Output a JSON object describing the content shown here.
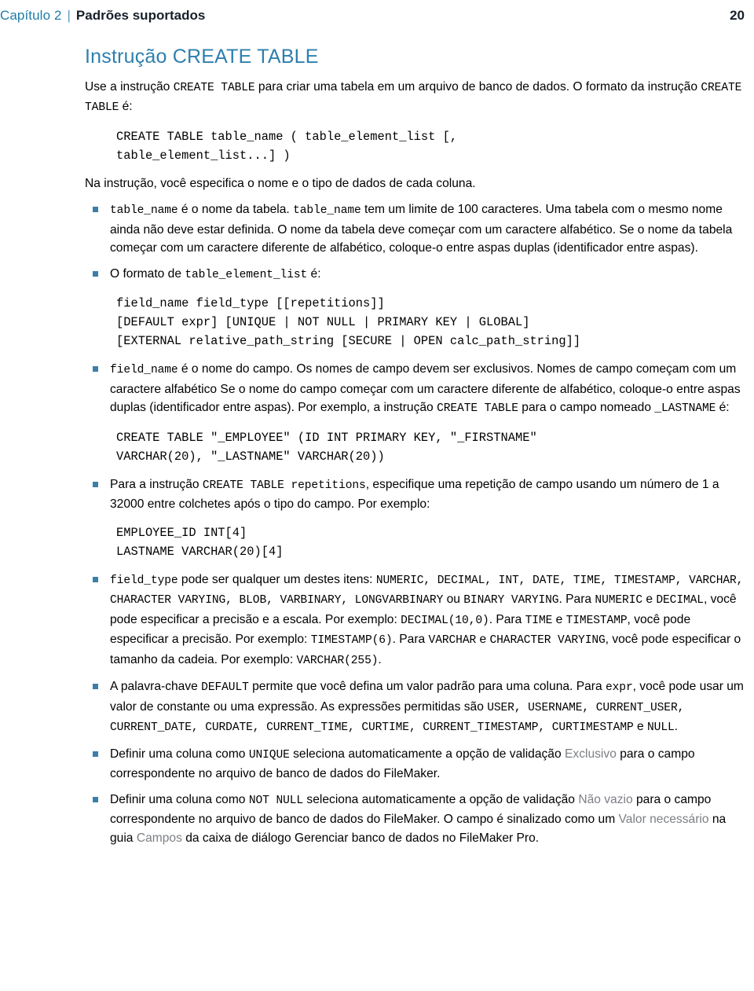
{
  "header": {
    "chapter": "Capítulo 2",
    "separator": "|",
    "section": "Padrões suportados",
    "page_number": "20"
  },
  "title": "Instrução CREATE TABLE",
  "intro": {
    "part1": "Use a instrução ",
    "code1": "CREATE TABLE",
    "part2": " para criar uma tabela em um arquivo de banco de dados. O formato da instrução ",
    "code2": "CREATE TABLE",
    "part3": " é:"
  },
  "code_block_1": "CREATE TABLE table_name ( table_element_list [,\ntable_element_list...] )",
  "para_after_code1": "Na instrução, você especifica o nome e o tipo de dados de cada coluna.",
  "bullets": {
    "table_name": {
      "code1": "table_name",
      "text1": " é o nome da tabela. ",
      "code2": "table_name",
      "text2": " tem um limite de 100 caracteres. Uma tabela com o mesmo nome ainda não deve estar definida. O nome da tabela deve começar com um caractere alfabético. Se o nome da tabela começar com um caractere diferente de alfabético, coloque-o entre aspas duplas (identificador entre aspas)."
    },
    "format_list": {
      "text1": "O formato de ",
      "code1": "table_element_list",
      "text2": " é:"
    },
    "field_name": {
      "code1": "field_name",
      "text1": " é o nome do campo. Os nomes de campo devem ser exclusivos. Nomes de campo começam com um caractere alfabético Se o nome do campo começar com um caractere diferente de alfabético, coloque-o entre aspas duplas (identificador entre aspas). Por exemplo, a instrução ",
      "code2": "CREATE TABLE",
      "text2": " para o campo nomeado ",
      "code3": "_LASTNAME",
      "text3": " é:"
    },
    "repetitions": {
      "text1": "Para a instrução ",
      "code1": "CREATE TABLE repetitions",
      "text2": ", especifique uma repetição de campo usando um número de 1 a 32000 entre colchetes após o tipo do campo. Por exemplo:"
    },
    "field_type": {
      "code1": "field_type",
      "text1": " pode ser qualquer um destes itens: ",
      "code2": "NUMERIC, DECIMAL, INT, DATE, TIME, TIMESTAMP, VARCHAR, CHARACTER VARYING, BLOB, VARBINARY, LONGVARBINARY",
      "text2": " ou ",
      "code3": "BINARY VARYING",
      "text3": ". Para ",
      "code4": "NUMERIC",
      "text4": " e ",
      "code5": "DECIMAL",
      "text5": ", você pode especificar a precisão e a escala. Por exemplo: ",
      "code6": "DECIMAL(10,0)",
      "text6": ". Para ",
      "code7": "TIME",
      "text7": " e ",
      "code8": "TIMESTAMP",
      "text8": ", você pode especificar a precisão. Por exemplo: ",
      "code9": "TIMESTAMP(6)",
      "text9": ". Para ",
      "code10": "VARCHAR",
      "text10": " e ",
      "code11": "CHARACTER VARYING",
      "text11": ", você pode especificar o tamanho da cadeia. Por exemplo: ",
      "code12": "VARCHAR(255)",
      "text12": "."
    },
    "default": {
      "text1": "A palavra-chave ",
      "code1": "DEFAULT",
      "text2": " permite que você defina um valor padrão para uma coluna. Para ",
      "code2": "expr",
      "text3": ", você pode usar um valor de constante ou uma expressão. As expressões permitidas são ",
      "code3": "USER, USERNAME, CURRENT_USER, CURRENT_DATE, CURDATE, CURRENT_TIME, CURTIME, CURRENT_TIMESTAMP, CURTIMESTAMP",
      "text4": " e ",
      "code4": "NULL",
      "text5": "."
    },
    "unique": {
      "text1": "Definir uma coluna como ",
      "code1": "UNIQUE",
      "text2": " seleciona automaticamente a opção de validação ",
      "hl1": "Exclusivo",
      "text3": " para o campo correspondente no arquivo de banco de dados do FileMaker."
    },
    "not_null": {
      "text1": "Definir uma coluna como ",
      "code1": "NOT NULL",
      "text2": " seleciona automaticamente a opção de validação ",
      "hl1": "Não vazio",
      "text3": " para o campo correspondente no arquivo de banco de dados do FileMaker. O campo é sinalizado como um ",
      "hl2": "Valor necessário",
      "text4": " na guia ",
      "hl3": "Campos",
      "text5": " da caixa de diálogo Gerenciar banco de dados no FileMaker Pro."
    }
  },
  "code_block_2": "field_name field_type [[repetitions]]\n[DEFAULT expr] [UNIQUE | NOT NULL | PRIMARY KEY | GLOBAL]\n[EXTERNAL relative_path_string [SECURE | OPEN calc_path_string]]",
  "code_block_3": "CREATE TABLE \"_EMPLOYEE\" (ID INT PRIMARY KEY, \"_FIRSTNAME\"\nVARCHAR(20), \"_LASTNAME\" VARCHAR(20))",
  "code_block_4": "EMPLOYEE_ID INT[4]\nLASTNAME VARCHAR(20)[4]",
  "colors": {
    "chapter_blue": "#1f7ba6",
    "title_blue": "#2e7fae",
    "bullet_blue": "#3b7fa8",
    "highlight_gray": "#7b7f85",
    "body_black": "#000000"
  }
}
